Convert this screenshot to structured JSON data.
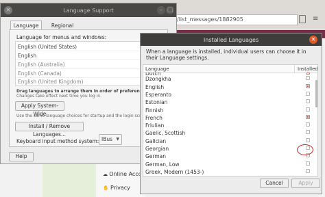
{
  "browser": {
    "url_fragment": "/list_messages/1882905",
    "background_items": [
      "Online Acco",
      "Privacy"
    ]
  },
  "language_support": {
    "title": "Language Support",
    "tabs": [
      "Language",
      "Regional Formats"
    ],
    "caption": "Language for menus and windows:",
    "languages": [
      "English (United States)",
      "English",
      "English (Australia)",
      "English (Canada)",
      "English (United Kingdom)"
    ],
    "drag_hint": "Drag languages to arrange them in order of preference.",
    "drag_sub": "Changes take effect next time you log in.",
    "apply_system_wide": "Apply System-Wide",
    "same_hint": "Use the same language choices for startup and the login screen.",
    "install_remove": "Install / Remove Languages...",
    "keyboard_label": "Keyboard input method system:",
    "keyboard_value": "IBus",
    "help": "Help"
  },
  "installed_languages": {
    "title": "Installed Languages",
    "description": "When a language is installed, individual users can choose it in their Language settings.",
    "col_language": "Language",
    "col_installed": "Installed",
    "rows": [
      {
        "name": "Dutch",
        "installed": true
      },
      {
        "name": "Dzongkha",
        "installed": false
      },
      {
        "name": "English",
        "installed": true
      },
      {
        "name": "Esperanto",
        "installed": false
      },
      {
        "name": "Estonian",
        "installed": false
      },
      {
        "name": "Finnish",
        "installed": false
      },
      {
        "name": "French",
        "installed": true
      },
      {
        "name": "Friulian",
        "installed": false
      },
      {
        "name": "Gaelic, Scottish",
        "installed": false
      },
      {
        "name": "Galician",
        "installed": false
      },
      {
        "name": "Georgian",
        "installed": false
      },
      {
        "name": "German",
        "installed": false
      },
      {
        "name": "German, Low",
        "installed": false
      },
      {
        "name": "Greek, Modern (1453-)",
        "installed": false
      }
    ],
    "cancel": "Cancel",
    "apply": "Apply"
  },
  "colors": {
    "accent": "#e05a2b",
    "titlebar": "#3e3d3b",
    "browser_header": "#7a2b48"
  }
}
